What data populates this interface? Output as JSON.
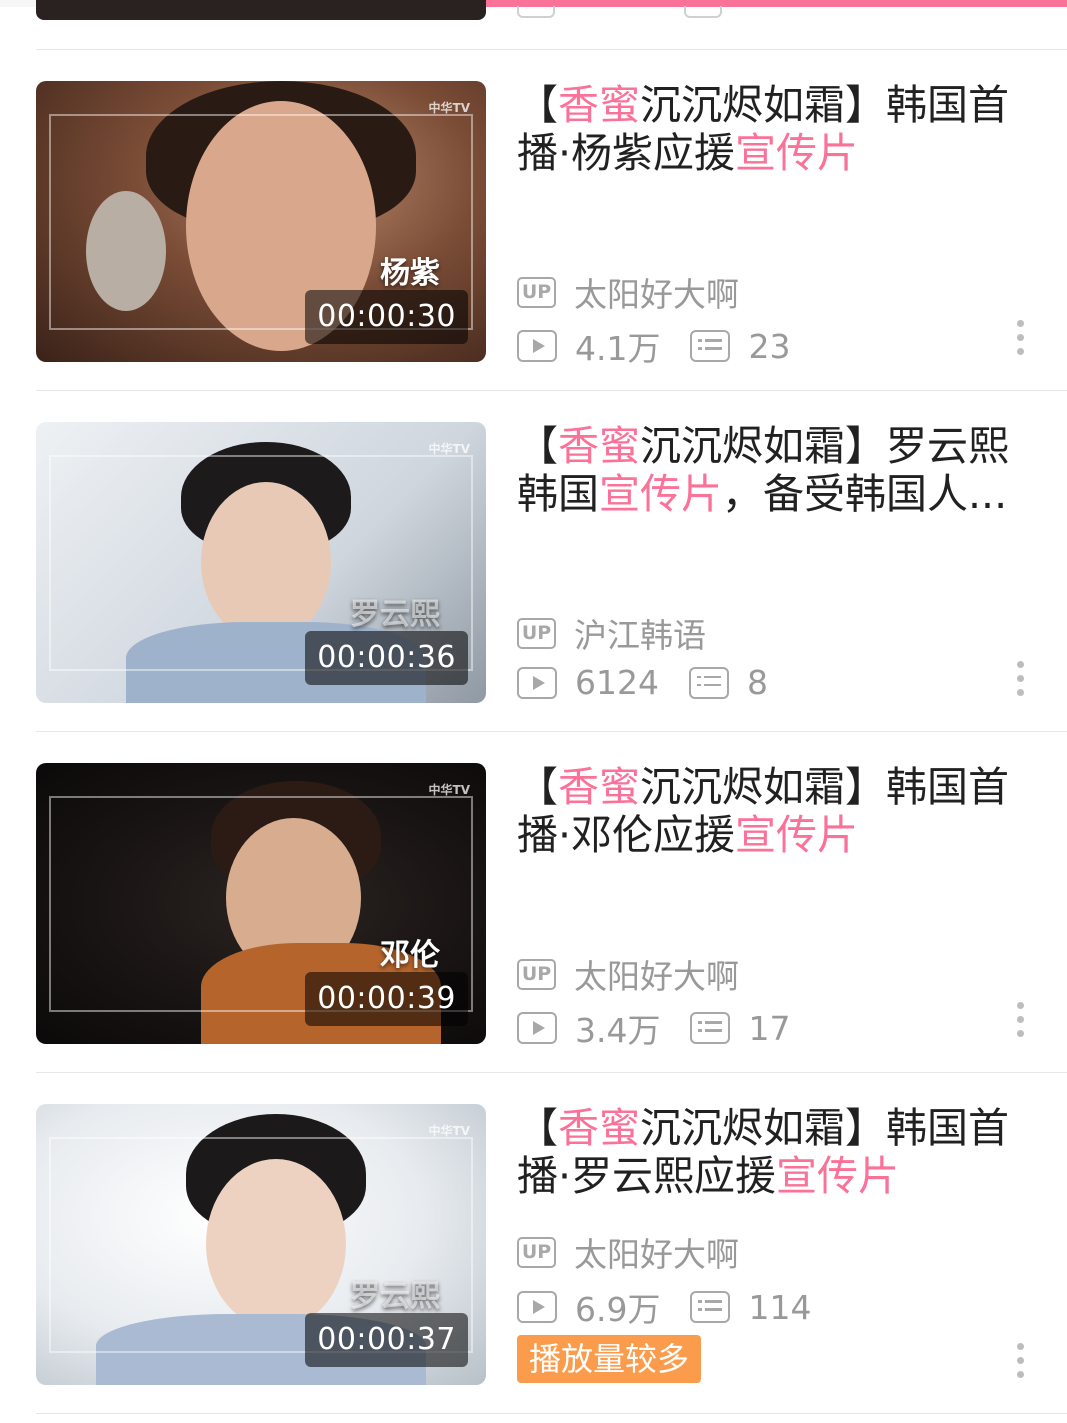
{
  "playback_progress": 0.11,
  "accent_color": "#fb7299",
  "badge_color": "#fa9c4b",
  "videos": [
    {
      "title_parts": [
        {
          "text": "【",
          "hl": false
        },
        {
          "text": "香蜜",
          "hl": true
        },
        {
          "text": "沉沉烬如霜",
          "hl": false
        },
        {
          "text": "】韩国首播·杨紫应援",
          "hl": false
        },
        {
          "text": "宣传片",
          "hl": true
        }
      ],
      "overlay_name": "杨紫",
      "duration": "00:00:30",
      "uploader": "太阳好大啊",
      "views": "4.1万",
      "danmaku": "23"
    },
    {
      "title_parts": [
        {
          "text": "【",
          "hl": false
        },
        {
          "text": "香蜜",
          "hl": true
        },
        {
          "text": "沉沉烬如霜",
          "hl": false
        },
        {
          "text": "】罗云熙韩国",
          "hl": false
        },
        {
          "text": "宣传片",
          "hl": true
        },
        {
          "text": "，备受韩国人...",
          "hl": false
        }
      ],
      "overlay_name": "罗云熙",
      "duration": "00:00:36",
      "uploader": "沪江韩语",
      "views": "6124",
      "danmaku": "8"
    },
    {
      "title_parts": [
        {
          "text": "【",
          "hl": false
        },
        {
          "text": "香蜜",
          "hl": true
        },
        {
          "text": "沉沉烬如霜",
          "hl": false
        },
        {
          "text": "】韩国首播·邓伦应援",
          "hl": false
        },
        {
          "text": "宣传片",
          "hl": true
        }
      ],
      "overlay_name": "邓伦",
      "duration": "00:00:39",
      "uploader": "太阳好大啊",
      "views": "3.4万",
      "danmaku": "17"
    },
    {
      "title_parts": [
        {
          "text": "【",
          "hl": false
        },
        {
          "text": "香蜜",
          "hl": true
        },
        {
          "text": "沉沉烬如霜",
          "hl": false
        },
        {
          "text": "】韩国首播·罗云熙应援",
          "hl": false
        },
        {
          "text": "宣传片",
          "hl": true
        }
      ],
      "overlay_name": "罗云熙",
      "duration": "00:00:37",
      "uploader": "太阳好大啊",
      "views": "6.9万",
      "danmaku": "114",
      "badge": "播放量较多"
    }
  ],
  "icons": {
    "uploader": "up-icon",
    "views": "play-count-icon",
    "danmaku": "danmaku-icon",
    "more": "more-vertical-icon"
  },
  "watermark": "中华TV"
}
